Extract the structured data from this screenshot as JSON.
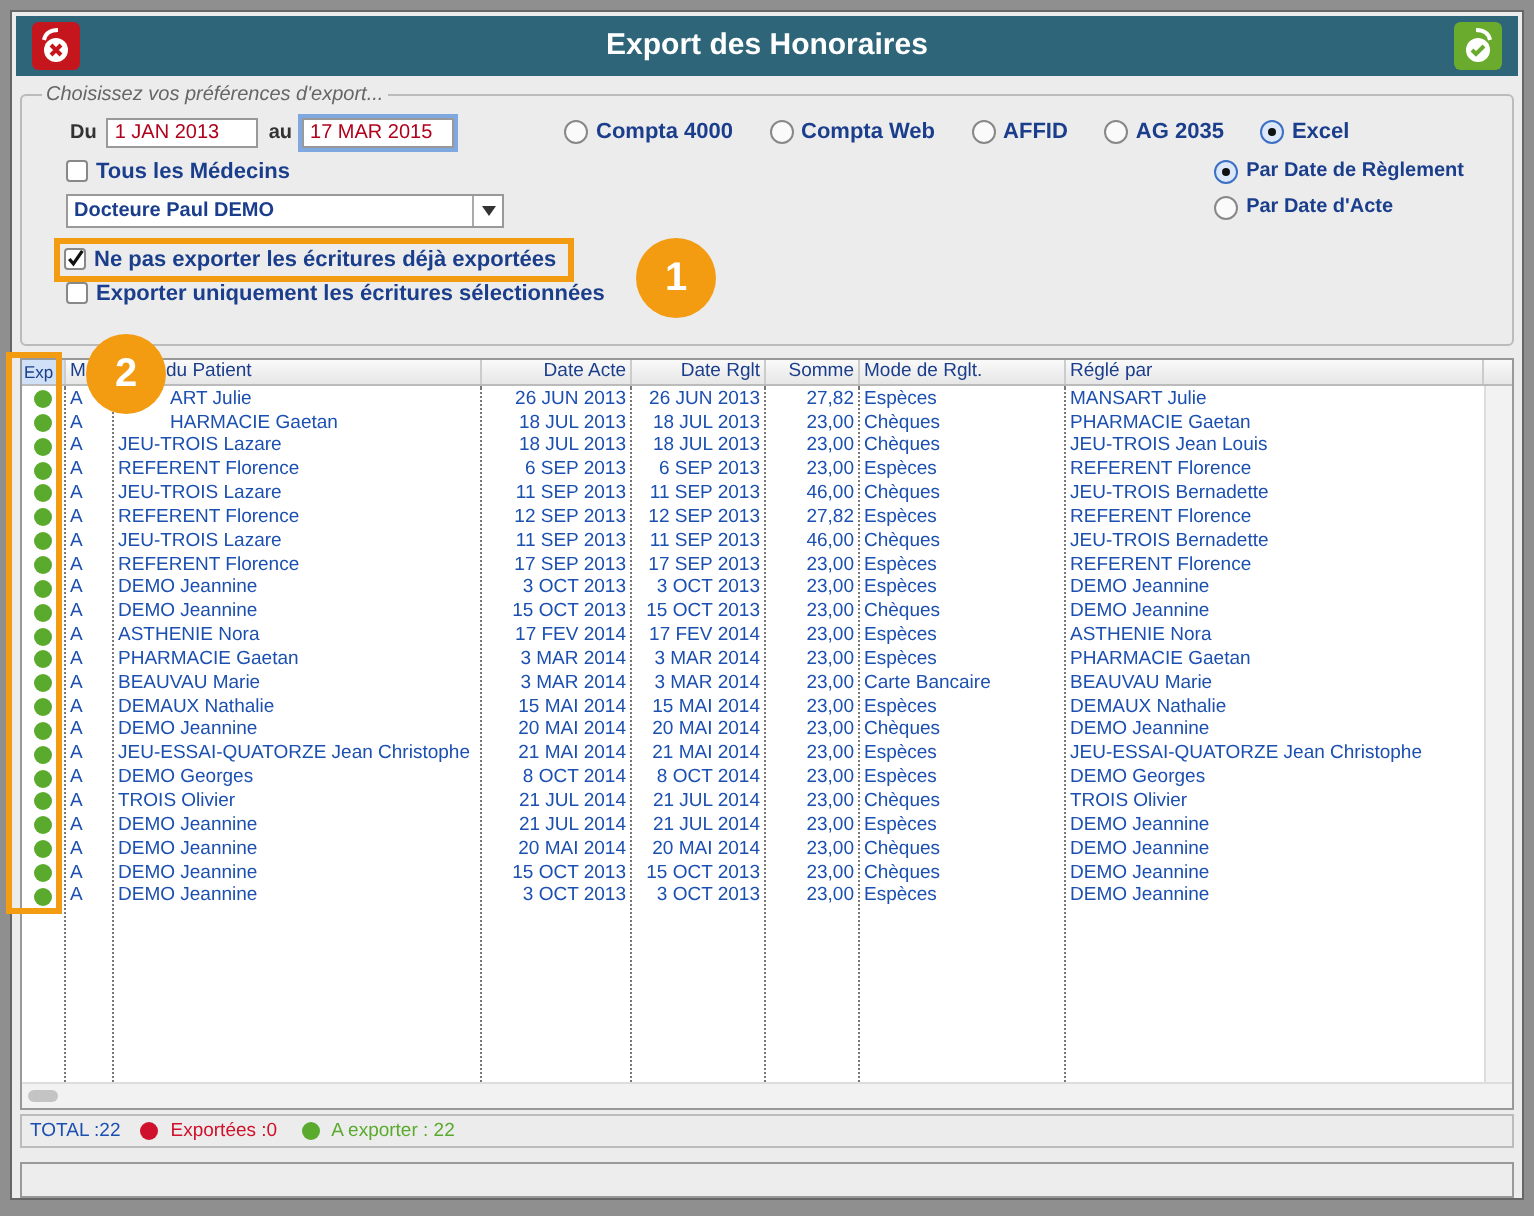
{
  "window": {
    "title": "Export des Honoraires"
  },
  "options": {
    "legend": "Choisissez vos préférences d'export...",
    "date_from": {
      "label": "Du",
      "value": "1 JAN 2013",
      "focused": false
    },
    "date_to": {
      "label": "au",
      "value": "17 MAR 2015",
      "focused": true
    },
    "formats": [
      {
        "label": "Compta 4000",
        "selected": false
      },
      {
        "label": "Compta Web",
        "selected": false
      },
      {
        "label": "AFFID",
        "selected": false
      },
      {
        "label": "AG 2035",
        "selected": false
      },
      {
        "label": "Excel",
        "selected": true
      }
    ],
    "all_doctors": {
      "label": "Tous les Médecins",
      "checked": false
    },
    "doctor": {
      "value": "Docteure Paul DEMO"
    },
    "date_modes": [
      {
        "label": "Par Date de Règlement",
        "selected": true
      },
      {
        "label": "Par Date d'Acte",
        "selected": false
      }
    ],
    "skip_exported": {
      "label": "Ne pas exporter les écritures déjà exportées",
      "checked": true
    },
    "only_selected": {
      "label": "Exporter uniquement les écritures sélectionnées",
      "checked": false
    }
  },
  "table": {
    "status_column": "Exp",
    "columns": [
      "M",
      "du Patient",
      "Date Acte",
      "Date Rglt",
      "Somme",
      "Mode de Rglt.",
      "Réglé par"
    ],
    "rows": [
      {
        "exported": false,
        "cells": [
          "A",
          "ART Julie",
          "26 JUN 2013",
          "26 JUN 2013",
          "27,82",
          "Espèces",
          "MANSART Julie"
        ]
      },
      {
        "exported": false,
        "cells": [
          "A",
          "HARMACIE Gaetan",
          "18 JUL 2013",
          "18 JUL 2013",
          "23,00",
          "Chèques",
          "PHARMACIE Gaetan"
        ]
      },
      {
        "exported": false,
        "cells": [
          "A",
          "JEU-TROIS Lazare",
          "18 JUL 2013",
          "18 JUL 2013",
          "23,00",
          "Chèques",
          "JEU-TROIS Jean Louis"
        ]
      },
      {
        "exported": false,
        "cells": [
          "A",
          "REFERENT Florence",
          "6 SEP 2013",
          "6 SEP 2013",
          "23,00",
          "Espèces",
          "REFERENT Florence"
        ]
      },
      {
        "exported": false,
        "cells": [
          "A",
          "JEU-TROIS Lazare",
          "11 SEP 2013",
          "11 SEP 2013",
          "46,00",
          "Chèques",
          "JEU-TROIS Bernadette"
        ]
      },
      {
        "exported": false,
        "cells": [
          "A",
          "REFERENT Florence",
          "12 SEP 2013",
          "12 SEP 2013",
          "27,82",
          "Espèces",
          "REFERENT Florence"
        ]
      },
      {
        "exported": false,
        "cells": [
          "A",
          "JEU-TROIS Lazare",
          "11 SEP 2013",
          "11 SEP 2013",
          "46,00",
          "Chèques",
          "JEU-TROIS Bernadette"
        ]
      },
      {
        "exported": false,
        "cells": [
          "A",
          "REFERENT Florence",
          "17 SEP 2013",
          "17 SEP 2013",
          "23,00",
          "Espèces",
          "REFERENT Florence"
        ]
      },
      {
        "exported": false,
        "cells": [
          "A",
          "DEMO Jeannine",
          "3 OCT 2013",
          "3 OCT 2013",
          "23,00",
          "Espèces",
          "DEMO Jeannine"
        ]
      },
      {
        "exported": false,
        "cells": [
          "A",
          "DEMO Jeannine",
          "15 OCT 2013",
          "15 OCT 2013",
          "23,00",
          "Chèques",
          "DEMO Jeannine"
        ]
      },
      {
        "exported": false,
        "cells": [
          "A",
          "ASTHENIE Nora",
          "17 FEV 2014",
          "17 FEV 2014",
          "23,00",
          "Espèces",
          "ASTHENIE Nora"
        ]
      },
      {
        "exported": false,
        "cells": [
          "A",
          "PHARMACIE Gaetan",
          "3 MAR 2014",
          "3 MAR 2014",
          "23,00",
          "Espèces",
          "PHARMACIE Gaetan"
        ]
      },
      {
        "exported": false,
        "cells": [
          "A",
          "BEAUVAU Marie",
          "3 MAR 2014",
          "3 MAR 2014",
          "23,00",
          "Carte Bancaire",
          "BEAUVAU Marie"
        ]
      },
      {
        "exported": false,
        "cells": [
          "A",
          "DEMAUX Nathalie",
          "15 MAI 2014",
          "15 MAI 2014",
          "23,00",
          "Espèces",
          "DEMAUX Nathalie"
        ]
      },
      {
        "exported": false,
        "cells": [
          "A",
          "DEMO Jeannine",
          "20 MAI 2014",
          "20 MAI 2014",
          "23,00",
          "Chèques",
          "DEMO Jeannine"
        ]
      },
      {
        "exported": false,
        "cells": [
          "A",
          "JEU-ESSAI-QUATORZE Jean Christophe",
          "21 MAI 2014",
          "21 MAI 2014",
          "23,00",
          "Espèces",
          "JEU-ESSAI-QUATORZE Jean Christophe"
        ]
      },
      {
        "exported": false,
        "cells": [
          "A",
          "DEMO Georges",
          "8 OCT 2014",
          "8 OCT 2014",
          "23,00",
          "Espèces",
          "DEMO Georges"
        ]
      },
      {
        "exported": false,
        "cells": [
          "A",
          "TROIS Olivier",
          "21 JUL 2014",
          "21 JUL 2014",
          "23,00",
          "Chèques",
          "TROIS Olivier"
        ]
      },
      {
        "exported": false,
        "cells": [
          "A",
          "DEMO Jeannine",
          "21 JUL 2014",
          "21 JUL 2014",
          "23,00",
          "Espèces",
          "DEMO Jeannine"
        ]
      },
      {
        "exported": false,
        "cells": [
          "A",
          "DEMO Jeannine",
          "20 MAI 2014",
          "20 MAI 2014",
          "23,00",
          "Chèques",
          "DEMO Jeannine"
        ]
      },
      {
        "exported": false,
        "cells": [
          "A",
          "DEMO Jeannine",
          "15 OCT 2013",
          "15 OCT 2013",
          "23,00",
          "Chèques",
          "DEMO Jeannine"
        ]
      },
      {
        "exported": false,
        "cells": [
          "A",
          "DEMO Jeannine",
          "3 OCT 2013",
          "3 OCT 2013",
          "23,00",
          "Espèces",
          "DEMO Jeannine"
        ]
      }
    ]
  },
  "status_bar": {
    "total": "TOTAL :22",
    "legend": [
      {
        "label": "Exportées :0",
        "color": "#d0112b"
      },
      {
        "label": "A exporter : 22",
        "color": "#5aaa2e"
      }
    ]
  },
  "callouts": [
    {
      "number": "1"
    },
    {
      "number": "2"
    }
  ]
}
